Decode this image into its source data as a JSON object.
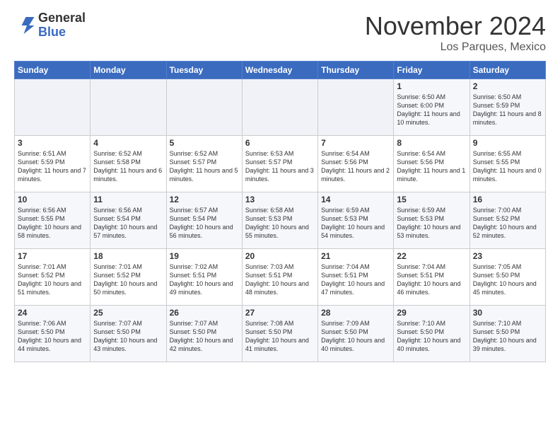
{
  "header": {
    "logo_general": "General",
    "logo_blue": "Blue",
    "month_title": "November 2024",
    "location": "Los Parques, Mexico"
  },
  "weekdays": [
    "Sunday",
    "Monday",
    "Tuesday",
    "Wednesday",
    "Thursday",
    "Friday",
    "Saturday"
  ],
  "weeks": [
    [
      {
        "day": "",
        "info": ""
      },
      {
        "day": "",
        "info": ""
      },
      {
        "day": "",
        "info": ""
      },
      {
        "day": "",
        "info": ""
      },
      {
        "day": "",
        "info": ""
      },
      {
        "day": "1",
        "info": "Sunrise: 6:50 AM\nSunset: 6:00 PM\nDaylight: 11 hours and 10 minutes."
      },
      {
        "day": "2",
        "info": "Sunrise: 6:50 AM\nSunset: 5:59 PM\nDaylight: 11 hours and 8 minutes."
      }
    ],
    [
      {
        "day": "3",
        "info": "Sunrise: 6:51 AM\nSunset: 5:59 PM\nDaylight: 11 hours and 7 minutes."
      },
      {
        "day": "4",
        "info": "Sunrise: 6:52 AM\nSunset: 5:58 PM\nDaylight: 11 hours and 6 minutes."
      },
      {
        "day": "5",
        "info": "Sunrise: 6:52 AM\nSunset: 5:57 PM\nDaylight: 11 hours and 5 minutes."
      },
      {
        "day": "6",
        "info": "Sunrise: 6:53 AM\nSunset: 5:57 PM\nDaylight: 11 hours and 3 minutes."
      },
      {
        "day": "7",
        "info": "Sunrise: 6:54 AM\nSunset: 5:56 PM\nDaylight: 11 hours and 2 minutes."
      },
      {
        "day": "8",
        "info": "Sunrise: 6:54 AM\nSunset: 5:56 PM\nDaylight: 11 hours and 1 minute."
      },
      {
        "day": "9",
        "info": "Sunrise: 6:55 AM\nSunset: 5:55 PM\nDaylight: 11 hours and 0 minutes."
      }
    ],
    [
      {
        "day": "10",
        "info": "Sunrise: 6:56 AM\nSunset: 5:55 PM\nDaylight: 10 hours and 58 minutes."
      },
      {
        "day": "11",
        "info": "Sunrise: 6:56 AM\nSunset: 5:54 PM\nDaylight: 10 hours and 57 minutes."
      },
      {
        "day": "12",
        "info": "Sunrise: 6:57 AM\nSunset: 5:54 PM\nDaylight: 10 hours and 56 minutes."
      },
      {
        "day": "13",
        "info": "Sunrise: 6:58 AM\nSunset: 5:53 PM\nDaylight: 10 hours and 55 minutes."
      },
      {
        "day": "14",
        "info": "Sunrise: 6:59 AM\nSunset: 5:53 PM\nDaylight: 10 hours and 54 minutes."
      },
      {
        "day": "15",
        "info": "Sunrise: 6:59 AM\nSunset: 5:53 PM\nDaylight: 10 hours and 53 minutes."
      },
      {
        "day": "16",
        "info": "Sunrise: 7:00 AM\nSunset: 5:52 PM\nDaylight: 10 hours and 52 minutes."
      }
    ],
    [
      {
        "day": "17",
        "info": "Sunrise: 7:01 AM\nSunset: 5:52 PM\nDaylight: 10 hours and 51 minutes."
      },
      {
        "day": "18",
        "info": "Sunrise: 7:01 AM\nSunset: 5:52 PM\nDaylight: 10 hours and 50 minutes."
      },
      {
        "day": "19",
        "info": "Sunrise: 7:02 AM\nSunset: 5:51 PM\nDaylight: 10 hours and 49 minutes."
      },
      {
        "day": "20",
        "info": "Sunrise: 7:03 AM\nSunset: 5:51 PM\nDaylight: 10 hours and 48 minutes."
      },
      {
        "day": "21",
        "info": "Sunrise: 7:04 AM\nSunset: 5:51 PM\nDaylight: 10 hours and 47 minutes."
      },
      {
        "day": "22",
        "info": "Sunrise: 7:04 AM\nSunset: 5:51 PM\nDaylight: 10 hours and 46 minutes."
      },
      {
        "day": "23",
        "info": "Sunrise: 7:05 AM\nSunset: 5:50 PM\nDaylight: 10 hours and 45 minutes."
      }
    ],
    [
      {
        "day": "24",
        "info": "Sunrise: 7:06 AM\nSunset: 5:50 PM\nDaylight: 10 hours and 44 minutes."
      },
      {
        "day": "25",
        "info": "Sunrise: 7:07 AM\nSunset: 5:50 PM\nDaylight: 10 hours and 43 minutes."
      },
      {
        "day": "26",
        "info": "Sunrise: 7:07 AM\nSunset: 5:50 PM\nDaylight: 10 hours and 42 minutes."
      },
      {
        "day": "27",
        "info": "Sunrise: 7:08 AM\nSunset: 5:50 PM\nDaylight: 10 hours and 41 minutes."
      },
      {
        "day": "28",
        "info": "Sunrise: 7:09 AM\nSunset: 5:50 PM\nDaylight: 10 hours and 40 minutes."
      },
      {
        "day": "29",
        "info": "Sunrise: 7:10 AM\nSunset: 5:50 PM\nDaylight: 10 hours and 40 minutes."
      },
      {
        "day": "30",
        "info": "Sunrise: 7:10 AM\nSunset: 5:50 PM\nDaylight: 10 hours and 39 minutes."
      }
    ]
  ]
}
